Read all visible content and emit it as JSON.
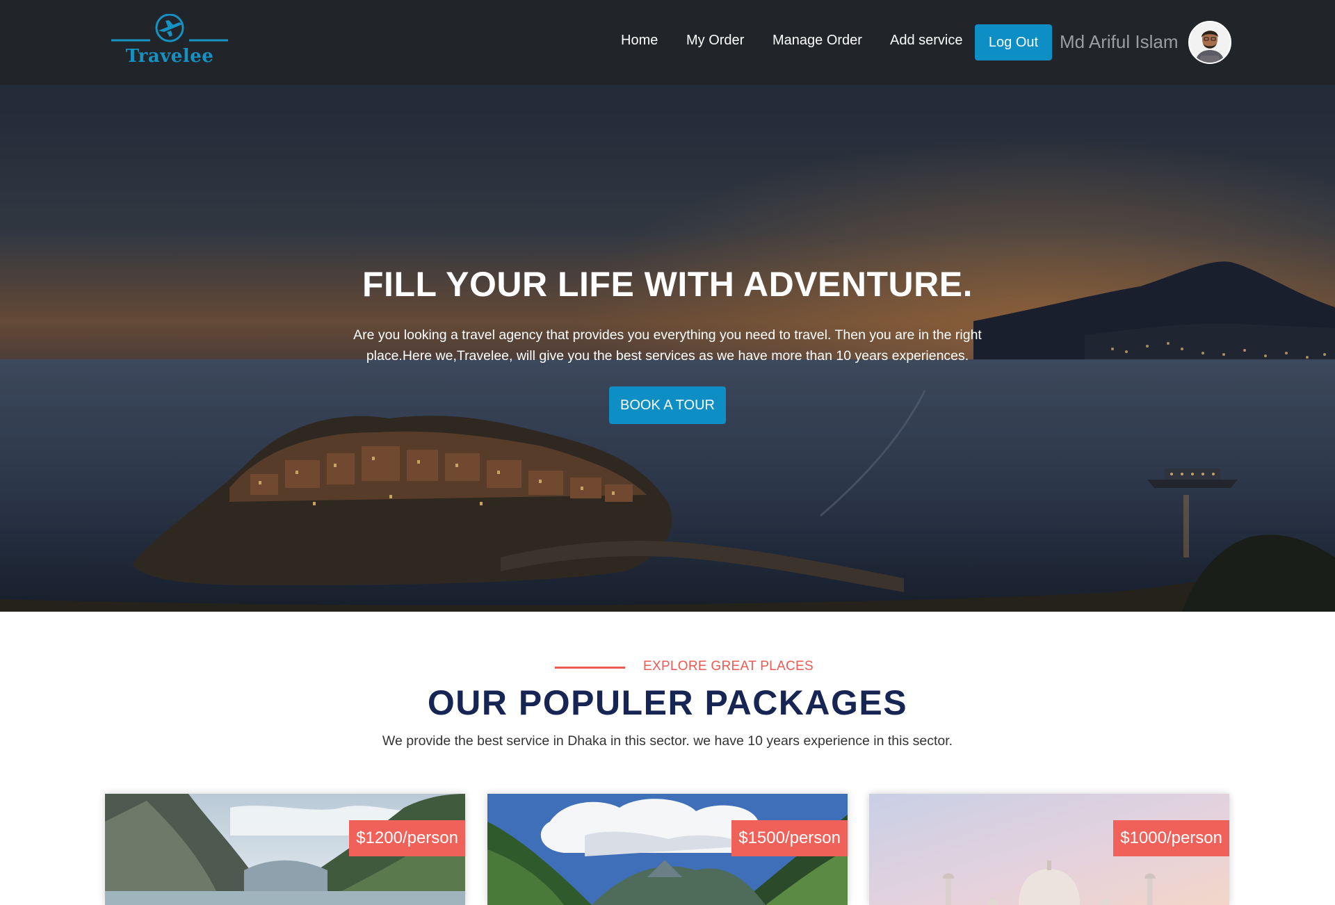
{
  "brand": {
    "name": "Travelee",
    "accent": "#1592c2"
  },
  "nav": {
    "links": [
      "Home",
      "My Order",
      "Manage Order",
      "Add service"
    ],
    "logout_label": "Log Out",
    "user_name": "Md Ariful Islam"
  },
  "hero": {
    "title": "FILL YOUR LIFE WITH ADVENTURE.",
    "text": "Are you looking a travel agency that provides you everything you need to travel. Then you are in the right place.Here we,Travelee, will give you the best services as we have more than 10 years experiences.",
    "button_label": "BOOK A TOUR"
  },
  "packages": {
    "tag": "EXPLORE GREAT PLACES",
    "title": "OUR POPULER PACKAGES",
    "subtitle": "We provide the best service in Dhaka in this sector. we have 10 years experience in this sector.",
    "cards": [
      {
        "price": "$1200/person"
      },
      {
        "price": "$1500/person"
      },
      {
        "price": "$1000/person"
      }
    ]
  },
  "colors": {
    "navbar": "#212529",
    "primary_button": "#0d8ec4",
    "tag_red": "#ee5a52",
    "title_navy": "#172554",
    "price_badge": "#f0615a"
  }
}
